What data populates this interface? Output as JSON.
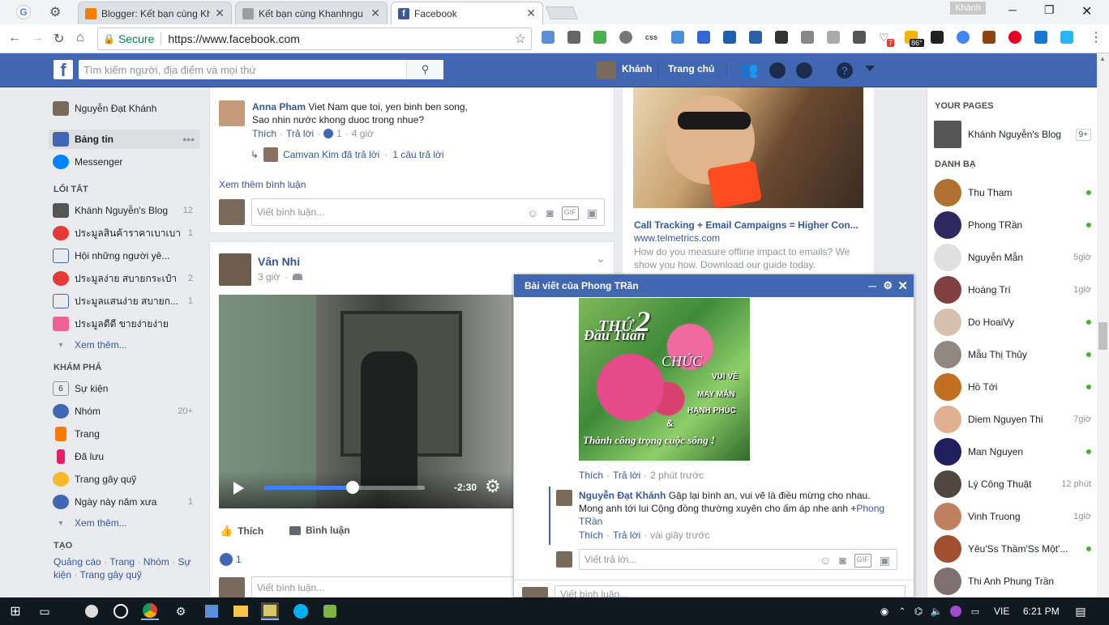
{
  "browser": {
    "tabs": [
      {
        "label": "Blogger: Kết bạn cùng Kh",
        "icon": "blogger-icon"
      },
      {
        "label": "Kết bạn cùng Khanhngu",
        "icon": "page-icon"
      },
      {
        "label": "Facebook",
        "icon": "facebook-icon"
      }
    ],
    "user_badge": "Khánh",
    "secure_label": "Secure",
    "url": "https://www.facebook.com",
    "ext_badges": {
      "notif": "7",
      "temp": "86°"
    }
  },
  "fbbar": {
    "search_placeholder": "Tìm kiếm người, địa điểm và mọi thứ",
    "user_name": "Khánh",
    "home_label": "Trang chủ"
  },
  "leftnav": {
    "profile_name": "Nguyễn Đạt Khánh",
    "main": [
      {
        "label": "Bảng tin"
      },
      {
        "label": "Messenger"
      }
    ],
    "shortcuts_title": "LỐI TẮT",
    "shortcuts": [
      {
        "label": "Khánh Nguyễn's Blog",
        "count": "12"
      },
      {
        "label": "ประมูลสินค้าราคาเบาเบา",
        "count": "1"
      },
      {
        "label": "Hội những người yê...",
        "count": ""
      },
      {
        "label": "ประมูลง่าย สบายกระเป๋า",
        "count": "2"
      },
      {
        "label": "ประมูลแสนง่าย สบายก...",
        "count": "1"
      },
      {
        "label": "ประมูลดีดี ขายง่ายง่าย",
        "count": ""
      }
    ],
    "see_more": "Xem thêm...",
    "explore_title": "KHÁM PHÁ",
    "explore": [
      {
        "label": "Sự kiện",
        "count": "",
        "icon_text": "6"
      },
      {
        "label": "Nhóm",
        "count": "20+"
      },
      {
        "label": "Trang",
        "count": ""
      },
      {
        "label": "Đã lưu",
        "count": ""
      },
      {
        "label": "Trang gây quỹ",
        "count": ""
      },
      {
        "label": "Ngày này năm xưa",
        "count": "1"
      }
    ],
    "see_more2": "Xem thêm...",
    "create_title": "TẠO",
    "create_links": [
      "Quảng cáo",
      "Trang",
      "Nhóm",
      "Sự kiện",
      "Trang gây quỹ"
    ],
    "create_sep": "·"
  },
  "post1": {
    "commenter": "Anna Pham",
    "comment_line1": "Viet Nam que toi, yen binh ben song,",
    "comment_line2": "Sao nhin nước khong duoc trong nhue?",
    "like": "Thích",
    "reply": "Trả lời",
    "like_count": "1",
    "time": "4 giờ",
    "reply_summary_name": "Camvan Kim đã trả lời",
    "reply_summary_count": "1 câu trả lời",
    "view_more": "Xem thêm bình luận",
    "write_placeholder": "Viết bình luận..."
  },
  "post2": {
    "author": "Vân Nhi",
    "time": "3 giờ",
    "video_time": "-2:30",
    "video_progress": 0.55,
    "like_action": "Thích",
    "comment_action": "Bình luận",
    "like_count": "1",
    "write_placeholder": "Viết bình luận..."
  },
  "ad": {
    "title": "Call Tracking + Email Campaigns = Higher Con...",
    "domain": "www.telmetrics.com",
    "desc": "How do you measure offline impact to emails? We show you how. Download our guide today."
  },
  "chat": {
    "title": "Bài viết của Phong TRần",
    "image_text": {
      "l1": "THỨ",
      "l1b": "2",
      "l2": "Đầu Tuần",
      "l3": "CHÚC",
      "l4": "VUI VẺ",
      "l5": "MAY MẮN",
      "l6": "HẠNH PHÚC",
      "l7": "&",
      "l8": "Thành công trọng cuộc sống !"
    },
    "img_like": "Thích",
    "img_reply": "Trả lời",
    "img_time": "2 phút trước",
    "reply_author": "Nguyễn Đạt Khánh",
    "reply_text1": "Gặp lại bình an, vui vẽ là điều mừng cho nhau.",
    "reply_text2": "Mong anh tới lui Cộng đồng thường xuyên cho ấm áp nhe anh +",
    "reply_tag": "Phong TRần",
    "reply_like": "Thích",
    "reply_reply": "Trả lời",
    "reply_time": "vài giây trước",
    "reply_placeholder": "Viết trả lời...",
    "comment_placeholder": "Viết bình luận..."
  },
  "rightcol": {
    "pages_title": "YOUR PAGES",
    "page_name": "Khánh Nguyễn's Blog",
    "page_badge": "9+",
    "contacts_title": "DANH BẠ",
    "contacts": [
      {
        "name": "Thu Tham",
        "status": "",
        "online": true,
        "color": "#b07030"
      },
      {
        "name": "Phong TRần",
        "status": "",
        "online": true,
        "color": "#302860"
      },
      {
        "name": "Nguyễn Mẫn",
        "status": "5giờ",
        "online": false,
        "color": "#e0e0e0"
      },
      {
        "name": "Hoàng Trí",
        "status": "1giờ",
        "online": false,
        "color": "#804040"
      },
      {
        "name": "Do HoaiVy",
        "status": "",
        "online": true,
        "color": "#d8c0b0"
      },
      {
        "name": "Mẫu Thị Thủy",
        "status": "",
        "online": true,
        "color": "#908880"
      },
      {
        "name": "Hồ Tới",
        "status": "",
        "online": true,
        "color": "#c07020"
      },
      {
        "name": "Diem Nguyen Thi",
        "status": "7giờ",
        "online": false,
        "color": "#e0b090"
      },
      {
        "name": "Man Nguyen",
        "status": "",
        "online": true,
        "color": "#202060"
      },
      {
        "name": "Lý Công Thuật",
        "status": "12 phút",
        "online": false,
        "color": "#504840"
      },
      {
        "name": "Vinh Truong",
        "status": "1giờ",
        "online": false,
        "color": "#c08060"
      },
      {
        "name": "Yêu'Ss Thầm'Ss Một'...",
        "status": "",
        "online": true,
        "color": "#a05030"
      },
      {
        "name": "Thi Anh Phung Trần",
        "status": "",
        "online": false,
        "color": "#807070"
      }
    ]
  },
  "taskbar": {
    "lang": "VIE",
    "time": "6:21 PM"
  }
}
